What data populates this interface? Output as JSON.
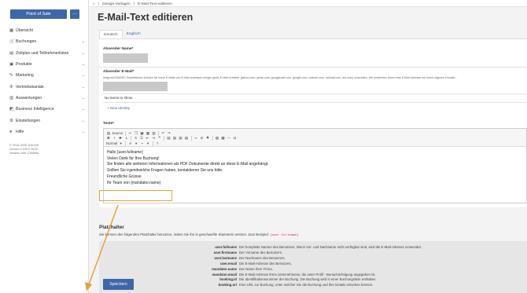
{
  "sidebar": {
    "pos_button": "Point of Sale",
    "more_button": "…",
    "items": [
      {
        "label": "Übersicht",
        "icon": "grid-icon",
        "glyph": "▦",
        "chevron": false
      },
      {
        "label": "Buchungen",
        "icon": "cart-icon",
        "glyph": "🛒",
        "chevron": true
      },
      {
        "label": "Zeitplan und Teilnehmerlisten",
        "icon": "calendar-icon",
        "glyph": "▤",
        "chevron": true
      },
      {
        "label": "Produkte",
        "icon": "box-icon",
        "glyph": "▣",
        "chevron": true
      },
      {
        "label": "Marketing",
        "icon": "megaphone-icon",
        "glyph": "✎",
        "chevron": true
      },
      {
        "label": "Vertriebskanäle",
        "icon": "network-icon",
        "glyph": "✣",
        "chevron": true
      },
      {
        "label": "Auswertungen",
        "icon": "chart-icon",
        "glyph": "▥",
        "chevron": true
      },
      {
        "label": "Business Intelligence",
        "icon": "bi-icon",
        "glyph": "◩",
        "chevron": true
      },
      {
        "label": "Einstellungen",
        "icon": "gear-icon",
        "glyph": "⚙",
        "chevron": true
      },
      {
        "label": "Hilfe",
        "icon": "help-icon",
        "glyph": "●",
        "chevron": true
      }
    ],
    "footer": [
      "© 2010-2025 TrekSoft",
      "Version 2.235.0.9122",
      "Session Info: 2166bfa"
    ]
  },
  "breadcrumb": {
    "home_icon": "⌂",
    "sep": "/",
    "items": [
      "Design-Vorlagen",
      "E-Mail-Text editieren"
    ]
  },
  "page": {
    "title": "E-Mail-Text editieren",
    "tabs": [
      "Deutsch",
      "Englisch"
    ],
    "sender_name_label": "Absender Name*",
    "sender_email_label": "Absender E-Mail*",
    "sender_email_hint": "Aufgrund DMARC-Restriktionen können wir keine E-Mails von E-Mail-Adressen einiger gratis E-Mail-Anbieter (yahoo.com, gmail.com, googlemail.com, google.com, outlook.com, hotmail.com, aol.com) versenden. Wir empfehlen Ihnen eine E-Mail-Adresse mit Ihrem eigenen Domain...",
    "no_items": "No items to show",
    "new_identity": "New identity",
    "text_label": "Texte*"
  },
  "editor": {
    "source_label": "Source",
    "format_label": "Normal",
    "lines": [
      "Hallo {user.fullname}",
      "Vielen Dank für Ihre Buchung!",
      "Sie finden alle weiteren Informationen als PDF Dokumente direkt an diese E-Mail angehängt.",
      "Sollten Sie irgendwelche Fragen haben, kontaktieren Sie uns bitte.",
      "Freundliche Grüsse",
      "Ihr Team von {mandator.name}"
    ]
  },
  "placeholders": {
    "title": "Platzhalter",
    "desc_before": "Sie können den folgenden Platzhalter benutzen, indem Sie ihn in geschweifte Klammern setzten. Zum Beispiel: ",
    "desc_example": "{user.fullname}",
    "desc_after": ".",
    "rows": [
      {
        "key": "user.fullname",
        "value": "Der komplette Namen des Benutzers. Wenn Vor- und Nachname nicht verfügbar sind, wird die E-Mail-Adresse verwendet."
      },
      {
        "key": "user.firstname",
        "value": "Der Vorname des Benutzers."
      },
      {
        "key": "user.lastname",
        "value": "Der Nachname des Benutzers."
      },
      {
        "key": "user.email",
        "value": "Die E-Mail-Adresse des Benutzers."
      },
      {
        "key": "mandator.name",
        "value": "Der Name Ihrer Firma."
      },
      {
        "key": "mandator.email",
        "value": "Die E-Mail-Adresse Ihres Unternehmens, die unter Profil - Benachrichtigung angegeben ist."
      },
      {
        "key": "booking.id",
        "value": "Die Identifikationsnummer der Buchung. Die Buchung wird in einer Buchungsliste enthalten."
      },
      {
        "key": "booking.url",
        "value": "Eine URL zur Buchung, unter welcher Sie die Buchung und ihre Details einsehen können."
      }
    ]
  },
  "save_button": "Speichern",
  "colors": {
    "accent": "#3e67a9",
    "highlight": "#e8a13a"
  }
}
